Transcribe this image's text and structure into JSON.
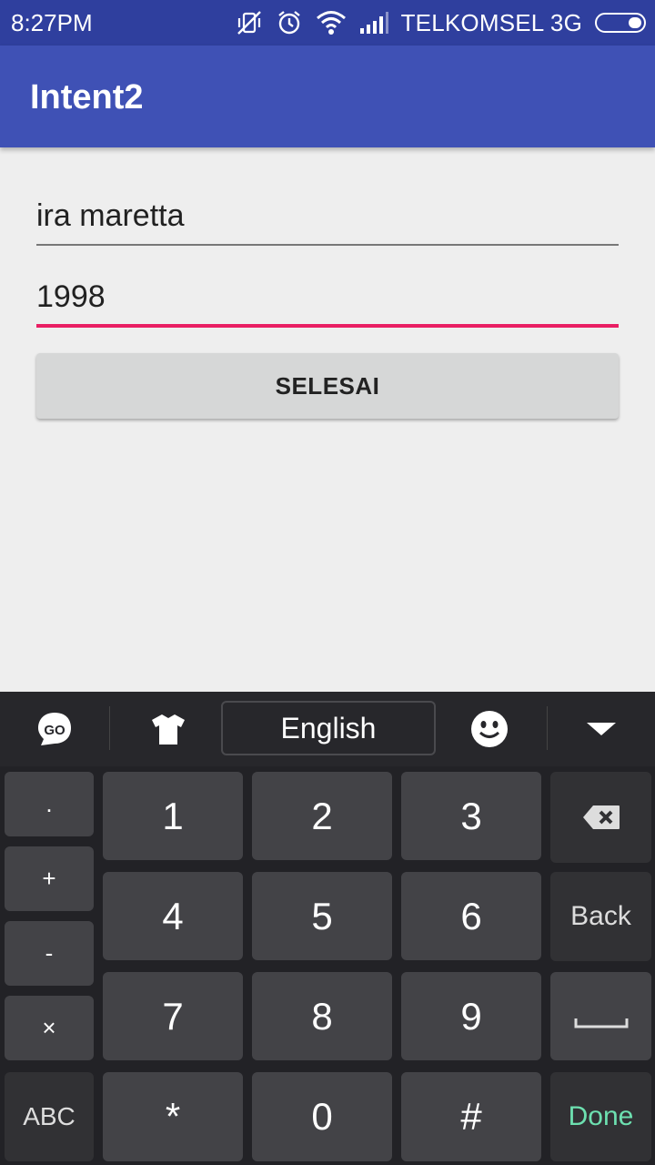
{
  "status_bar": {
    "time": "8:27PM",
    "carrier": "TELKOMSEL 3G",
    "icons": [
      "vibrate-off-icon",
      "alarm-icon",
      "wifi-icon",
      "signal-icon",
      "battery-icon"
    ]
  },
  "app_bar": {
    "title": "Intent2",
    "color": "#3f51b5"
  },
  "form": {
    "name_value": "ira maretta",
    "year_value": "1998",
    "submit_label": "SELESAI",
    "focus_color": "#e91e63"
  },
  "keyboard": {
    "toolbar": {
      "go_icon": "go-keyboard-icon",
      "theme_icon": "tshirt-icon",
      "language": "English",
      "emoji_icon": "emoji-icon",
      "collapse_icon": "chevron-down-icon"
    },
    "side_keys": [
      ".",
      "+",
      "-",
      "×"
    ],
    "digits": [
      "1",
      "2",
      "3",
      "4",
      "5",
      "6",
      "7",
      "8",
      "9",
      "*",
      "0",
      "#"
    ],
    "back_label": "Back",
    "abc_label": "ABC",
    "done_label": "Done",
    "done_color": "#6de0b0",
    "delete_icon": "backspace-icon",
    "space_icon": "space-bar-icon"
  }
}
